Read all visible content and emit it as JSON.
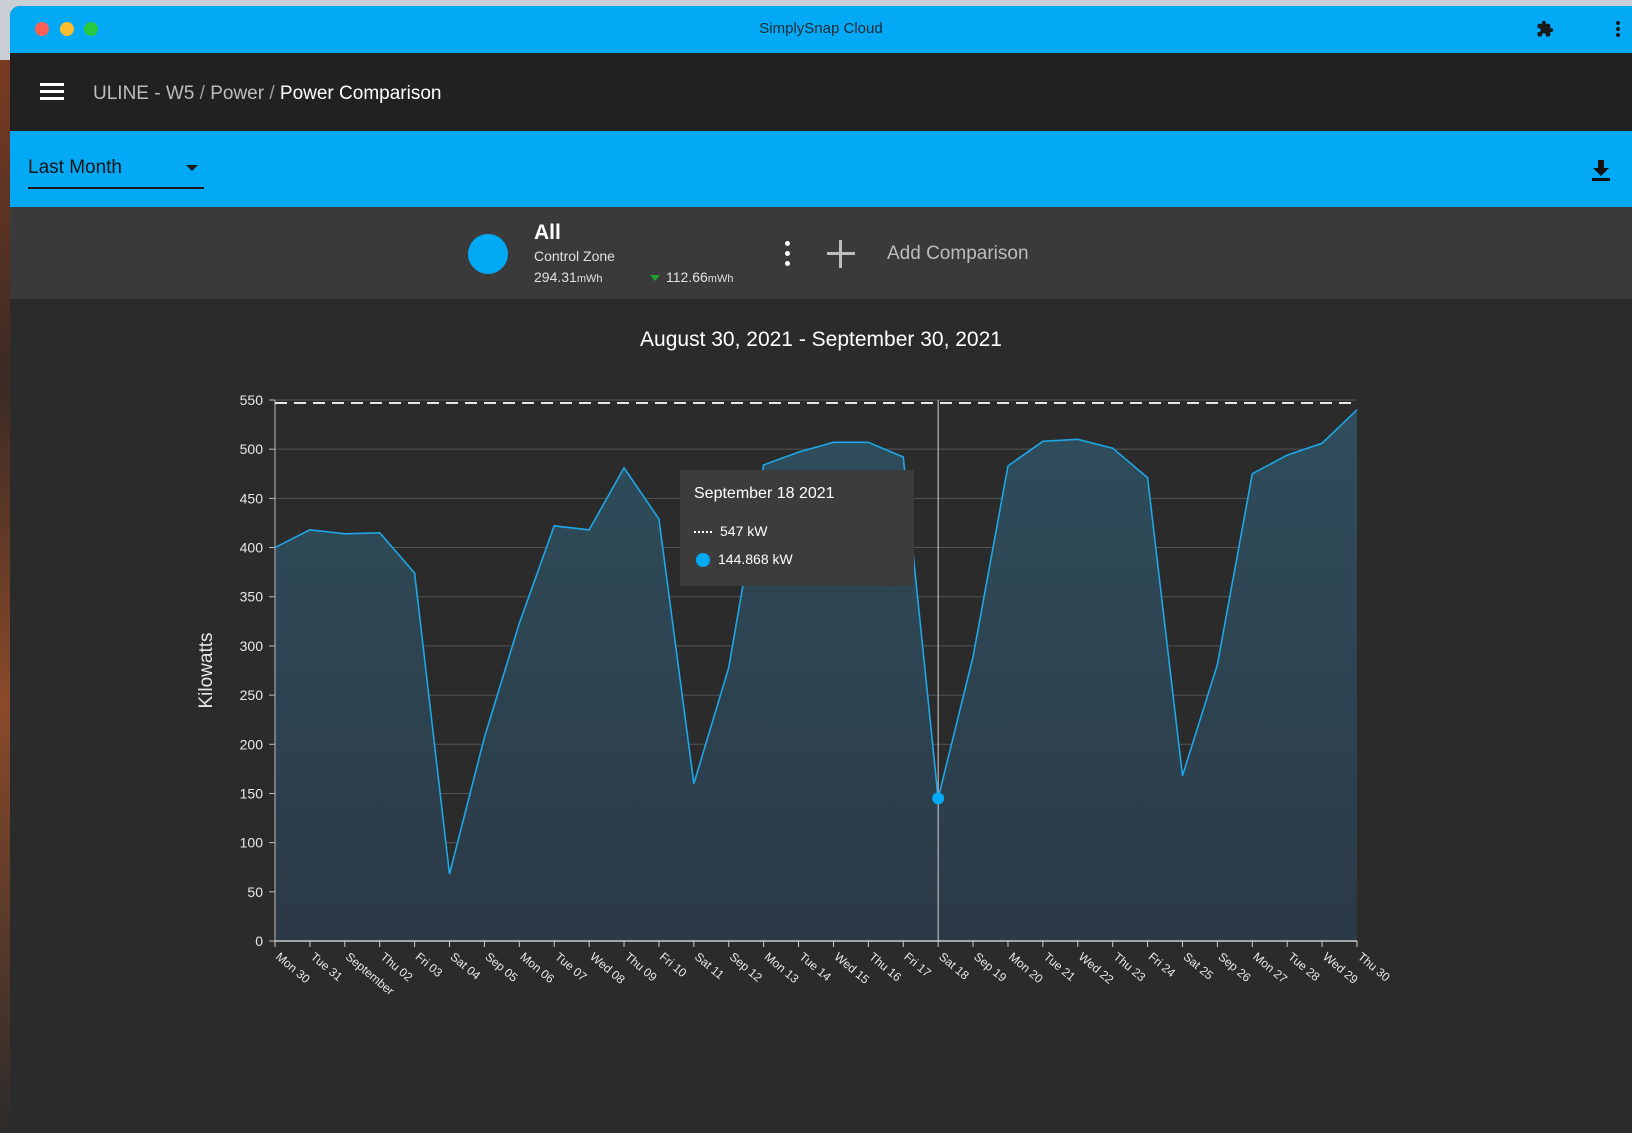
{
  "window": {
    "title": "SimplySnap Cloud"
  },
  "breadcrumb": {
    "site": "ULINE - W5",
    "section": "Power",
    "page": "Power Comparison",
    "separator": "/"
  },
  "toolbar": {
    "range_value": "Last Month"
  },
  "summary": {
    "name": "All",
    "type": "Control Zone",
    "energy_value": "294.31",
    "energy_unit": "mWh",
    "delta_value": "112.66",
    "delta_unit": "mWh",
    "add_label": "Add Comparison"
  },
  "colors": {
    "accent": "#03a9f4",
    "appbar": "#212121",
    "panel": "#3a3a3a",
    "delta_down": "#1fa12d"
  },
  "icons": {
    "menu": "hamburger-icon",
    "download": "download-icon",
    "extensions": "puzzle-icon",
    "more": "more-vert-icon",
    "add": "plus-icon"
  },
  "chart_title": "August 30, 2021 - September 30, 2021",
  "tooltip": {
    "date": "September 18 2021",
    "peak": "547 kW",
    "value": "144.868 kW"
  },
  "chart_data": {
    "type": "area",
    "title": "August 30, 2021 - September 30, 2021",
    "xlabel": "",
    "ylabel": "Kilowatts",
    "ylim": [
      0,
      550
    ],
    "yticks": [
      0,
      50,
      100,
      150,
      200,
      250,
      300,
      350,
      400,
      450,
      500,
      550
    ],
    "grid": true,
    "categories": [
      "Mon 30",
      "Tue 31",
      "September",
      "Thu 02",
      "Fri 03",
      "Sat 04",
      "Sep 05",
      "Mon 06",
      "Tue 07",
      "Wed 08",
      "Thu 09",
      "Fri 10",
      "Sat 11",
      "Sep 12",
      "Mon 13",
      "Tue 14",
      "Wed 15",
      "Thu 16",
      "Fri 17",
      "Sat 18",
      "Sep 19",
      "Mon 20",
      "Tue 21",
      "Wed 22",
      "Thu 23",
      "Fri 24",
      "Sat 25",
      "Sep 26",
      "Mon 27",
      "Tue 28",
      "Wed 29",
      "Thu 30"
    ],
    "series": [
      {
        "values": [
          400,
          418,
          414,
          415,
          374,
          68,
          207,
          323,
          422,
          418,
          481,
          429,
          160,
          278,
          484,
          497,
          507,
          507,
          492,
          145,
          289,
          483,
          508,
          510,
          501,
          471,
          168,
          281,
          475,
          494,
          506,
          540
        ]
      }
    ],
    "reference_line": {
      "value": 547,
      "style": "dashed"
    },
    "highlight_index": 19
  }
}
